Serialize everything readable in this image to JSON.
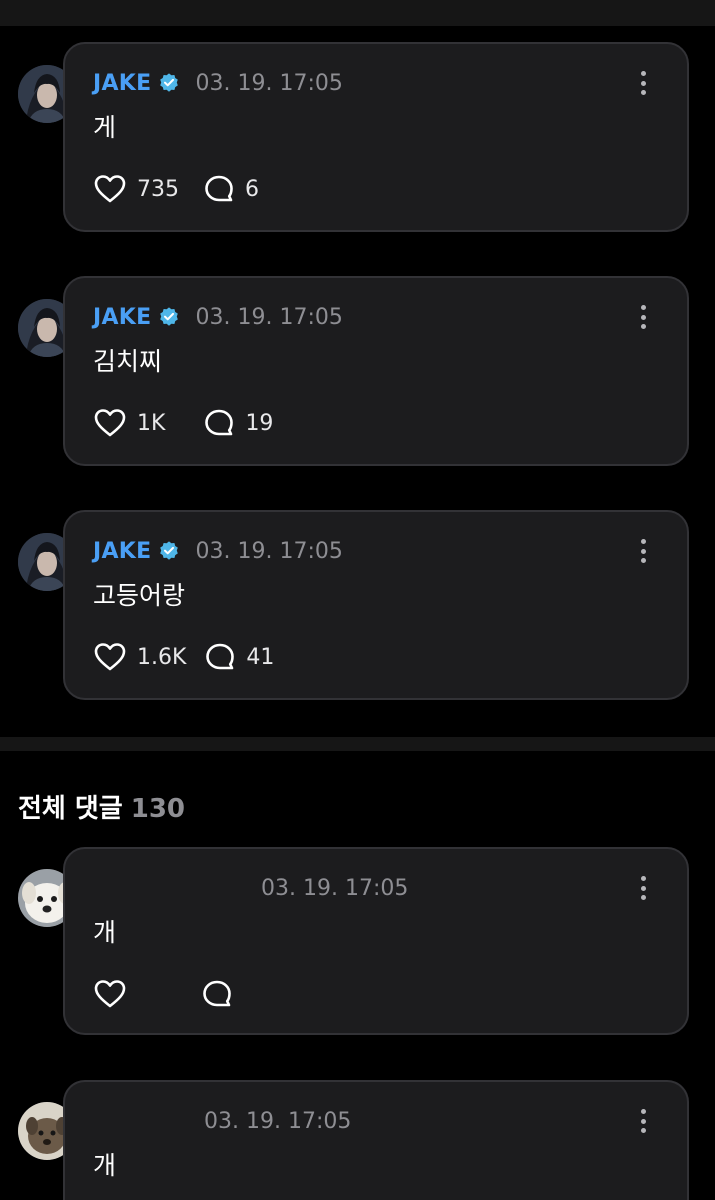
{
  "author_posts": [
    {
      "author": "JAKE",
      "time": "03. 19. 17:05",
      "text": "게",
      "likes": "735",
      "comments": "6"
    },
    {
      "author": "JAKE",
      "time": "03. 19. 17:05",
      "text": "김치찌",
      "likes": "1K",
      "comments": "19"
    },
    {
      "author": "JAKE",
      "time": "03. 19. 17:05",
      "text": "고등어랑",
      "likes": "1.6K",
      "comments": "41"
    }
  ],
  "comments_section": {
    "title": "전체 댓글",
    "count": "130"
  },
  "comments": [
    {
      "time": "03. 19. 17:05",
      "text": "개"
    },
    {
      "time": "03. 19. 17:05",
      "text": "개"
    }
  ],
  "icons": {
    "verified": "verified-badge-icon",
    "more": "more-vertical-icon",
    "like": "heart-icon",
    "comment": "comment-bubble-icon"
  },
  "colors": {
    "background": "#000000",
    "card": "#1c1c1e",
    "card_border": "#323236",
    "author": "#4a9ff5",
    "verified": "#4fb6e8",
    "muted": "#8e8e93"
  }
}
